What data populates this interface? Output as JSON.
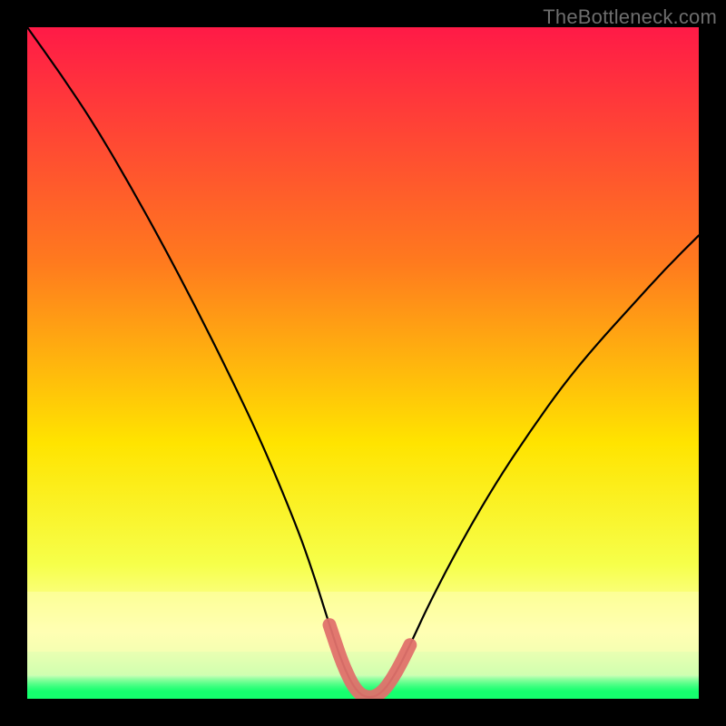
{
  "watermark": "TheBottleneck.com",
  "colors": {
    "top": "#ff1a47",
    "mid_high": "#ff7a1e",
    "mid": "#ffe400",
    "mid_low": "#f6ff4a",
    "pale": "#ffffb3",
    "green": "#15ff6e",
    "curve": "#000000",
    "tolerance": "#e0716c",
    "frame": "#000000"
  },
  "chart_data": {
    "type": "line",
    "title": "",
    "xlabel": "",
    "ylabel": "",
    "xlim": [
      0,
      100
    ],
    "ylim": [
      0,
      100
    ],
    "grid": false,
    "legend": false,
    "annotations": [],
    "series": [
      {
        "name": "bottleneck-curve",
        "color": "#000000",
        "x": [
          0,
          5,
          10,
          15,
          20,
          25,
          30,
          35,
          40,
          42.5,
          45,
          47,
          49,
          51,
          53,
          55,
          57,
          60,
          65,
          70,
          75,
          80,
          85,
          90,
          95,
          100
        ],
        "y": [
          100,
          93,
          85.5,
          77,
          68,
          58.5,
          48.5,
          38,
          26,
          19,
          11,
          5,
          1,
          0,
          1,
          4,
          8,
          14.5,
          24,
          32.5,
          40,
          47,
          53,
          58.5,
          64,
          69
        ]
      },
      {
        "name": "tolerance-band",
        "color": "#e0716c",
        "type": "area",
        "x": [
          45,
          47,
          49,
          51,
          53,
          55,
          57
        ],
        "y": [
          11,
          5,
          1,
          0,
          1,
          4,
          8
        ],
        "note": "thick pink overlay hugging curve bottom"
      }
    ],
    "background_gradient_stops": [
      {
        "pos": 0.0,
        "color": "#ff1a47"
      },
      {
        "pos": 0.35,
        "color": "#ff7a1e"
      },
      {
        "pos": 0.62,
        "color": "#ffe400"
      },
      {
        "pos": 0.8,
        "color": "#f6ff4a"
      },
      {
        "pos": 0.9,
        "color": "#ffffb3"
      },
      {
        "pos": 0.965,
        "color": "#d0ffb0"
      },
      {
        "pos": 1.0,
        "color": "#15ff6e"
      }
    ],
    "pale_band_y": [
      7,
      16
    ],
    "green_band_y": [
      0,
      3.5
    ]
  }
}
